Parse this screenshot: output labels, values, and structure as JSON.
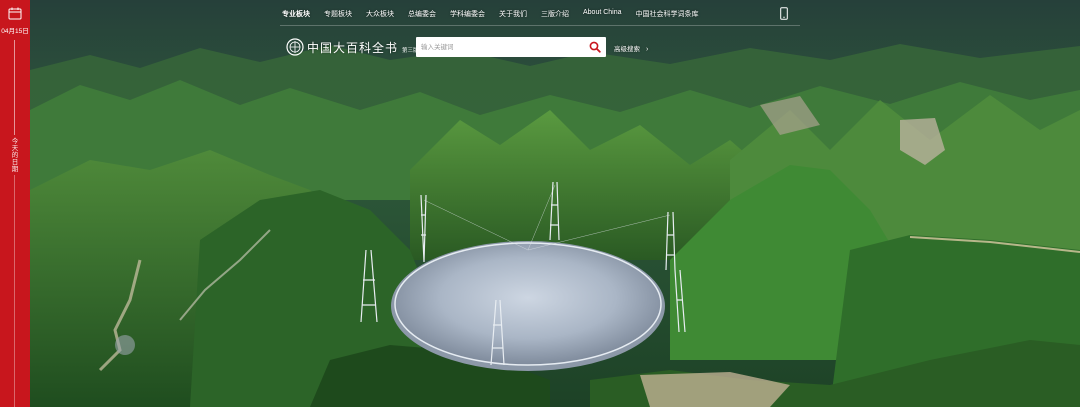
{
  "sidebar": {
    "date": "04月15日",
    "vertical_label": "今天的日期"
  },
  "nav": {
    "items": [
      {
        "label": "专业板块",
        "active": true
      },
      {
        "label": "专题板块",
        "active": false
      },
      {
        "label": "大众板块",
        "active": false
      },
      {
        "label": "总编委会",
        "active": false
      },
      {
        "label": "学科编委会",
        "active": false
      },
      {
        "label": "关于我们",
        "active": false
      },
      {
        "label": "三版介绍",
        "active": false
      },
      {
        "label": "About China",
        "active": false
      },
      {
        "label": "中国社会科学词条库",
        "active": false
      }
    ],
    "mobile_icon": "mobile-phone-icon"
  },
  "header": {
    "logo_text": "中国大百科全书",
    "edition_text": "第三版·网络版"
  },
  "search": {
    "placeholder": "输入关键词",
    "icon": "search-icon",
    "advanced_label": "高级搜索"
  },
  "colors": {
    "rail": "#c8161d",
    "search_icon": "#c8161d"
  }
}
